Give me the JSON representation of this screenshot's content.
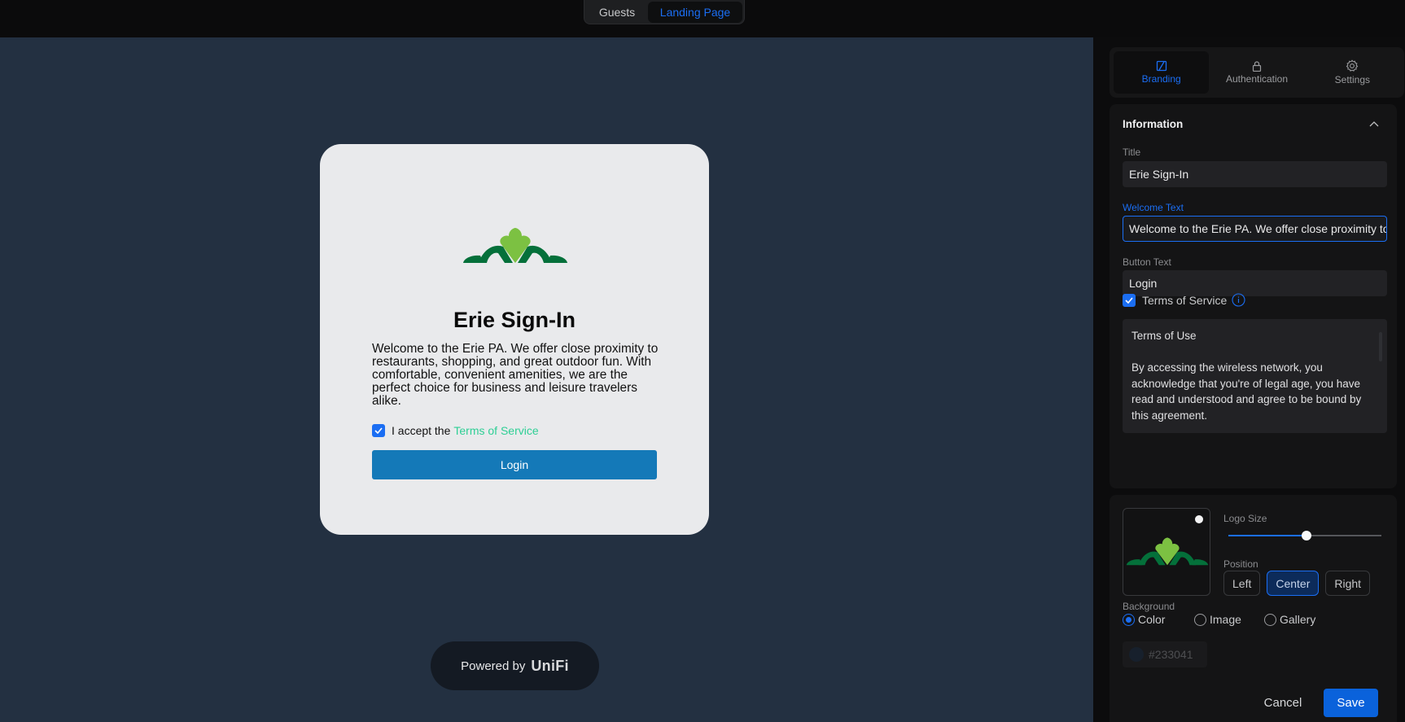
{
  "topbar": {
    "tabs": [
      {
        "label": "Guests",
        "active": false
      },
      {
        "label": "Landing Page",
        "active": true
      }
    ]
  },
  "preview": {
    "title": "Erie Sign-In",
    "welcome_text": "Welcome to the Erie PA. We offer close proximity to restaurants, shopping, and great outdoor fun. With comfortable, convenient amenities, we are the perfect choice for business and leisure travelers alike.",
    "accept_prefix": "I accept the",
    "accept_link": "Terms of Service",
    "accept_checked": true,
    "login_button": "Login",
    "powered_by": "Powered by",
    "brand": "UniFi",
    "background_color": "#233041",
    "button_color": "#1479b8",
    "link_color": "#2ecf95"
  },
  "panel": {
    "tabs": [
      {
        "label": "Branding",
        "icon": "branding-icon",
        "active": true
      },
      {
        "label": "Authentication",
        "icon": "lock-icon",
        "active": false
      },
      {
        "label": "Settings",
        "icon": "gear-icon",
        "active": false
      }
    ],
    "information": {
      "heading": "Information",
      "title_label": "Title",
      "title_value": "Erie Sign-In",
      "welcome_label": "Welcome Text",
      "welcome_value": "Welcome to the Erie PA. We offer close proximity to restaurants, shopping, and great outdoor fun. With comfortable, convenient amenities, we are the perfect choice for business and leisure travelers alike.",
      "button_label": "Button Text",
      "button_value": "Login",
      "tos_label": "Terms of Service",
      "tos_checked": true,
      "tos_heading": "Terms of Use",
      "tos_body": "By accessing the wireless network, you acknowledge that you're of legal age, you have read and understood and agree to be bound by this agreement."
    },
    "logo": {
      "size_label": "Logo Size",
      "size_value_percent": 51,
      "position_label": "Position",
      "positions": [
        {
          "label": "Left",
          "active": false
        },
        {
          "label": "Center",
          "active": true
        },
        {
          "label": "Right",
          "active": false
        }
      ]
    },
    "background": {
      "label": "Background",
      "options": [
        {
          "label": "Color",
          "selected": true
        },
        {
          "label": "Image",
          "selected": false
        },
        {
          "label": "Gallery",
          "selected": false
        }
      ],
      "color_value": "#233041"
    },
    "actions": {
      "cancel": "Cancel",
      "save": "Save"
    }
  },
  "colors": {
    "accent": "#1b6ef3",
    "logo_light_green": "#7cc142",
    "logo_dark_green": "#04703a"
  }
}
